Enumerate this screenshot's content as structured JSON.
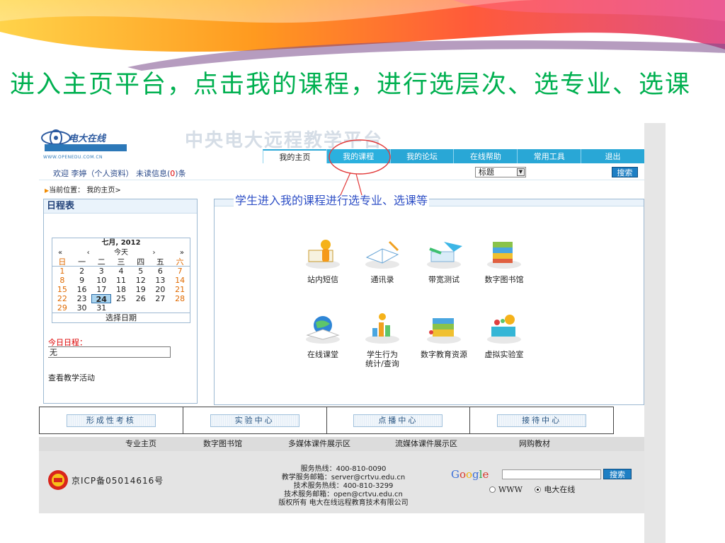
{
  "slide_title": "进入主页平台，点击我的课程，进行选层次、选专业、选课",
  "site": {
    "logo_text": "电大在线",
    "logo_url_text": "WWW.OPENEDU.COM.CN",
    "brand_title": "中央电大远程教学平台"
  },
  "nav": {
    "tabs": [
      "我的主页",
      "我的课程",
      "我的论坛",
      "在线帮助",
      "常用工具",
      "退出"
    ],
    "active_index": 0
  },
  "welcome": {
    "prefix": "欢迎 李婷（",
    "profile_link": "个人资料",
    "middle": "）  未读信息(",
    "unread": "0",
    "suffix": ")条"
  },
  "search": {
    "type_selected": "标题",
    "button": "搜索"
  },
  "breadcrumb": {
    "label": "当前位置：",
    "path": "我的主页>"
  },
  "schedule": {
    "heading": "日程表",
    "calendar": {
      "month_label": "七月, 2012",
      "nav": [
        "«",
        "‹",
        "今天",
        "›",
        "»"
      ],
      "weekdays": [
        "日",
        "一",
        "二",
        "三",
        "四",
        "五",
        "六"
      ],
      "days": [
        "1",
        "2",
        "3",
        "4",
        "5",
        "6",
        "7",
        "8",
        "9",
        "10",
        "11",
        "12",
        "13",
        "14",
        "15",
        "16",
        "17",
        "18",
        "19",
        "20",
        "21",
        "22",
        "23",
        "24",
        "25",
        "26",
        "27",
        "28",
        "29",
        "30",
        "31"
      ],
      "selected_day": "24",
      "footer": "选择日期"
    },
    "today_label": "今日日程：",
    "today_value": "无",
    "activity_link": "查看教学活动"
  },
  "annotation": "学生进入我的课程进行选专业、选课等",
  "tiles": [
    {
      "label": "站内短信",
      "icon": "mail-person-icon"
    },
    {
      "label": "通讯录",
      "icon": "address-book-icon"
    },
    {
      "label": "带宽测试",
      "icon": "bandwidth-test-icon"
    },
    {
      "label": "数字图书馆",
      "icon": "digital-library-icon"
    },
    {
      "label": "在线课堂",
      "icon": "online-classroom-icon"
    },
    {
      "label": "学生行为\n统计/查询",
      "icon": "statistics-icon"
    },
    {
      "label": "数字教育资源",
      "icon": "education-resources-icon"
    },
    {
      "label": "虚拟实验室",
      "icon": "virtual-lab-icon"
    }
  ],
  "bottom_buttons": [
    "形成性考核",
    "实验中心",
    "点播中心",
    "接待中心"
  ],
  "footer_links": [
    "专业主页",
    "数字图书馆",
    "多媒体课件展示区",
    "流媒体课件展示区",
    "网购教材"
  ],
  "footer": {
    "icp": "京ICP备05014616号",
    "contact_lines": [
      "服务热线：400-810-0090",
      "教学服务邮箱：server@crtvu.edu.cn",
      "技术服务热线：400-810-3299",
      "技术服务邮箱：open@crtvu.edu.cn",
      "版权所有 电大在线远程教育技术有限公司"
    ],
    "google_label": "Google",
    "google_button": "搜索",
    "radio_www": "WWW",
    "radio_site": "电大在线",
    "radio_selected": "电大在线"
  },
  "colors": {
    "title_green": "#00b050",
    "nav_blue": "#29a7d6",
    "annotation_blue": "#2e4fc6",
    "ellipse_red": "#e23a3a"
  }
}
